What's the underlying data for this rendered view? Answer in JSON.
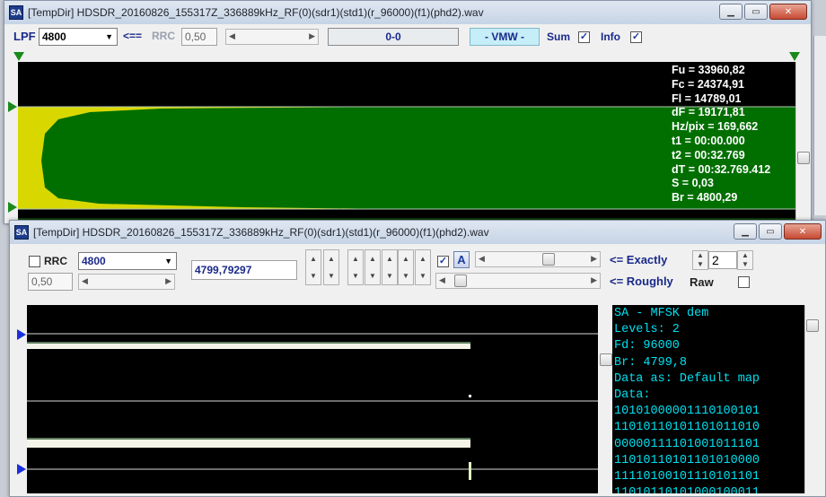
{
  "colors": {
    "spectrum_green": "#006f00",
    "spectrum_yellow": "#d8d800",
    "title_blue": "#1a2a8a",
    "terminal_cyan": "#00e0f0"
  },
  "window1": {
    "title": "[TempDir] HDSDR_20160826_155317Z_336889kHz_RF(0)(sdr1)(std1)(r_96000)(f1)(phd2).wav",
    "icon_text": "SA",
    "toolbar": {
      "lpf_label": "LPF",
      "lpf_value": "4800",
      "arrow_label": "<==",
      "rrc_label": "RRC",
      "rrc_value": "0,50",
      "range_value": "0-0",
      "vmw_label": "- VMW -",
      "sum_label": "Sum",
      "info_label": "Info"
    },
    "info_lines": [
      "Fu = 33960,82",
      "Fc = 24374,91",
      "Fl = 14789,01",
      "dF = 19171,81",
      "Hz/pix = 169,662",
      "t1 = 00:00.000",
      "t2 = 00:32.769",
      "dT = 00:32.769.412",
      "S = 0,03",
      "Br = 4800,29"
    ]
  },
  "window2": {
    "title": "[TempDir] HDSDR_20160826_155317Z_336889kHz_RF(0)(sdr1)(std1)(r_96000)(f1)(phd2).wav",
    "icon_text": "SA",
    "toolbar": {
      "rrc_label": "RRC",
      "rrc_value": "0,50",
      "filter_value": "4800",
      "baud_value": "4799,79297",
      "exactly_label": "<= Exactly",
      "roughly_label": "<= Roughly",
      "levels_value": "2",
      "raw_label": "Raw",
      "a_button": "A"
    },
    "terminal_lines": [
      "SA - MFSK dem",
      "Levels: 2",
      "Fd: 96000",
      "Br: 4799,8",
      "Data as: Default map",
      "Data:",
      "10101000001110100101",
      "11010110101101011010",
      "00000111101001011101",
      "11010110101101010000",
      "11110100101110101101",
      "11010110101000100011"
    ]
  }
}
